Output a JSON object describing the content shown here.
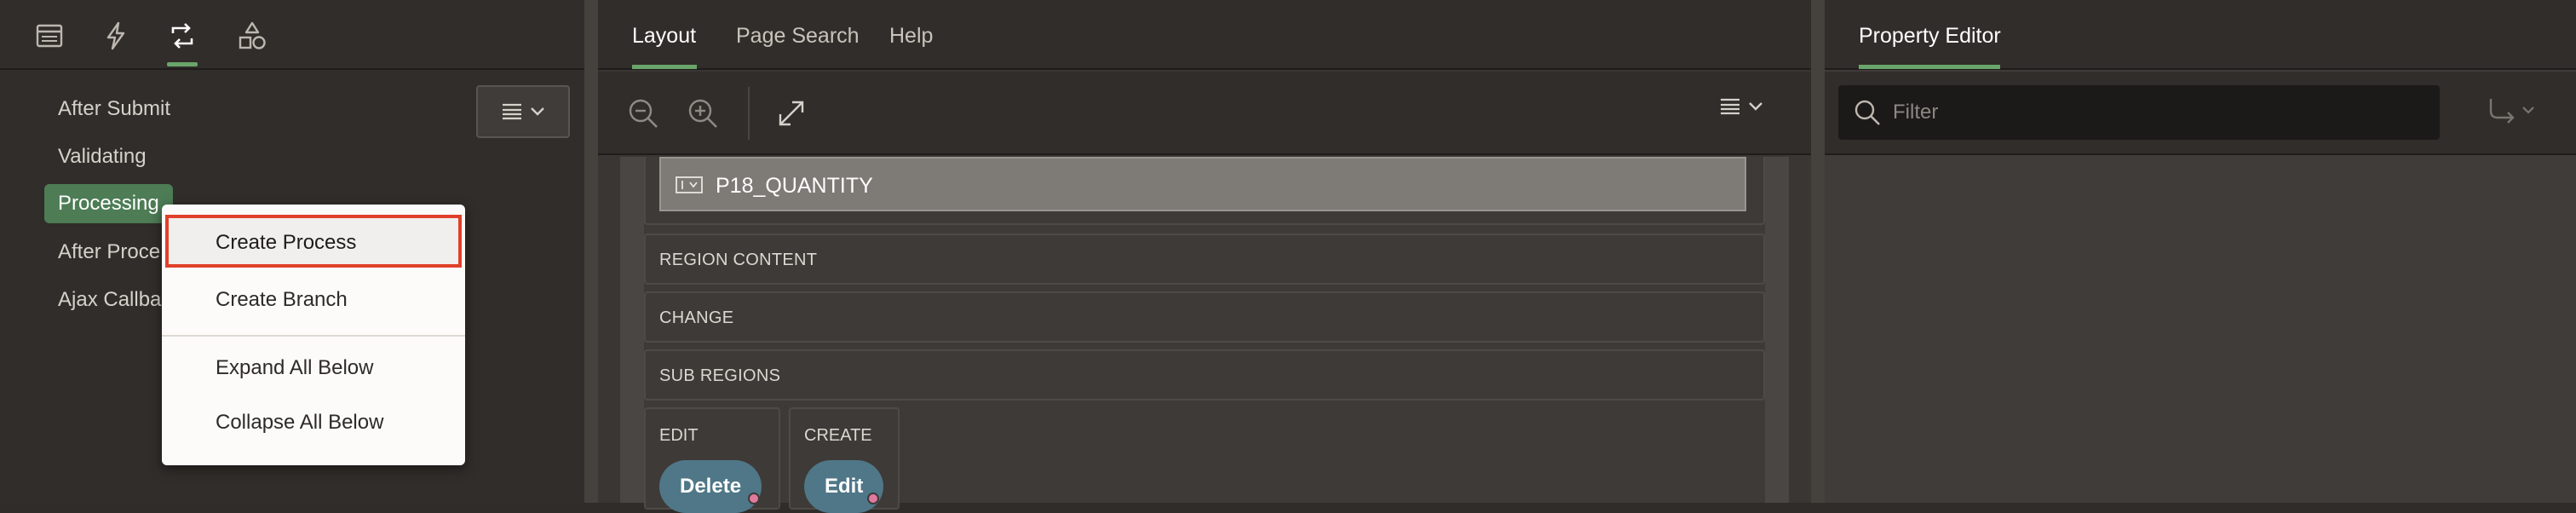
{
  "left": {
    "tree_items": [
      "After Submit",
      "Validating",
      "Processing",
      "After Proce",
      "Ajax Callba"
    ],
    "context_menu": {
      "items": [
        "Create Process",
        "Create Branch",
        "Expand All Below",
        "Collapse All Below"
      ]
    }
  },
  "center": {
    "tabs": [
      "Layout",
      "Page Search",
      "Help"
    ],
    "item_label": "P18_QUANTITY",
    "regions": [
      "REGION CONTENT",
      "CHANGE",
      "SUB REGIONS"
    ],
    "slots": [
      {
        "label": "EDIT",
        "button": "Delete"
      },
      {
        "label": "CREATE",
        "button": "Edit"
      }
    ]
  },
  "right": {
    "title": "Property Editor",
    "filter_placeholder": "Filter"
  },
  "colors": {
    "accent_green": "#6aa56a",
    "selected_bg": "#4d7c55",
    "highlight_border": "#e0402b",
    "button_blue": "#4f7788"
  }
}
